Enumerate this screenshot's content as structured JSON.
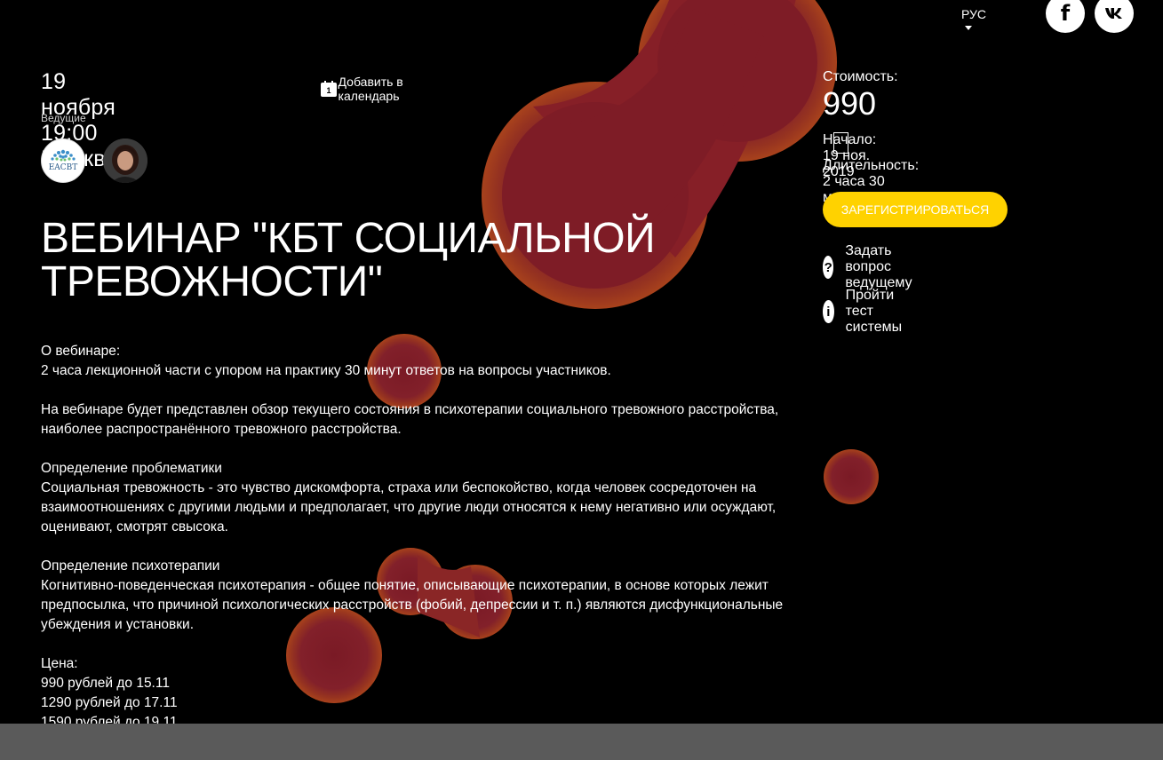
{
  "colors": {
    "background": "#000000",
    "accent_button": "#ffd200",
    "blob_outer": "#a8421c",
    "blob_inner": "#7f1d24",
    "footer_bar": "#5a5a5a"
  },
  "header": {
    "language": "РУС",
    "language_icon": "chevron-down-icon",
    "social": [
      {
        "label": "f",
        "icon": "facebook-icon"
      },
      {
        "label": "vk",
        "icon": "vk-icon"
      }
    ]
  },
  "event": {
    "datetime": "19 ноября 19:00 Москва",
    "add_to_calendar": "Добавить в календарь",
    "calendar_icon_day": "1",
    "hosts_label": "Ведущие",
    "hosts": [
      {
        "kind": "organization-logo",
        "logo_text": "EACBT"
      },
      {
        "kind": "person-photo"
      }
    ],
    "title": "ВЕБИНАР \"КБТ СОЦИАЛЬНОЙ ТРЕВОЖНОСТИ\""
  },
  "description": {
    "about_heading": "О вебинаре:",
    "about_text": "2 часа лекционной части с упором на практику 30 минут ответов на вопросы участников.",
    "overview": "На вебинаре будет представлен обзор текущего состояния в психотерапии социального тревожного расстройства, наиболее распространённого тревожного расстройства.",
    "problem_heading": "Определение проблематики",
    "problem_text": "Социальная тревожность - это чувство дискомфорта, страха или беспокойство, когда человек сосредоточен на взаимоотношениях с другими людьми и предполагает, что другие люди относятся к нему негативно или осуждают, оценивают, смотрят свысока.",
    "therapy_heading": "Определение психотерапии",
    "therapy_text": "Когнитивно-поведенческая психотерапия - общее понятие, описывающие психотерапии, в основе которых лежит предпосылка, что причиной психологических расстройств (фобий, депрессии и т. п.) являются дисфункциональные убеждения и установки.",
    "price_heading": "Цена:",
    "prices": [
      "990 рублей до 15.11",
      "1290 рублей до 17.11",
      "1590 рублей до 19.11"
    ]
  },
  "sidebar": {
    "cost_label": "Стоимость:",
    "cost_value": "990",
    "start": "Начало: 19 ноя. 2019",
    "duration": "Длительность: 2 часа 30 минут",
    "register_button": "ЗАРЕГИСТРИРОВАТЬСЯ",
    "ask_question": "Задать вопрос ведущему",
    "ask_icon_glyph": "?",
    "system_test": "Пройти тест системы",
    "info_icon_glyph": "i"
  }
}
